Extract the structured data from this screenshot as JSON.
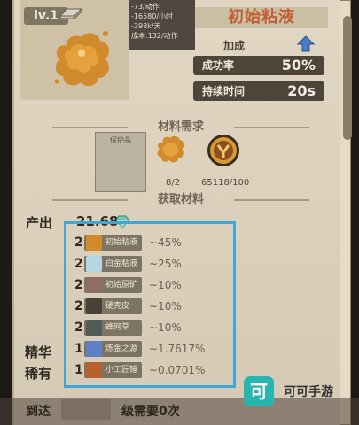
{
  "item": {
    "level": "lv.1",
    "title": "初始粘液",
    "mini_stats": [
      "-73/动作",
      "-16580/小时",
      "-398k/天",
      "成本:132/动作"
    ],
    "bonus_label": "加成",
    "stats": [
      {
        "label": "成功率",
        "value": "50%"
      },
      {
        "label": "持续时间",
        "value": "20s"
      }
    ]
  },
  "requirements": {
    "header": "材料需求",
    "protect_label": "保护品",
    "materials": [
      {
        "name": "slime",
        "count": "8/2"
      },
      {
        "name": "coin",
        "count": "65118/100"
      }
    ]
  },
  "acquire": {
    "header": "获取材料",
    "output_label": "产出",
    "output_value": "21.68",
    "essence_label": "精华",
    "rare_label": "稀有",
    "drops": [
      {
        "qty": "2",
        "label": "初始粘液",
        "pct": "~45%"
      },
      {
        "qty": "2",
        "label": "白金粘液",
        "pct": "~25%"
      },
      {
        "qty": "2",
        "label": "初始原矿",
        "pct": "~10%"
      },
      {
        "qty": "2",
        "label": "硬壳皮",
        "pct": "~10%"
      },
      {
        "qty": "2",
        "label": "蜂网草",
        "pct": "~10%"
      },
      {
        "qty": "1",
        "label": "炼金之源",
        "pct": "~1.7617%"
      },
      {
        "qty": "1",
        "label": "小工匠锤",
        "pct": "~0.0701%"
      }
    ]
  },
  "footer": {
    "arrive_label": "到达",
    "need_label": "级需要0次"
  },
  "watermark": {
    "logo": "可",
    "text": "可可手游"
  }
}
